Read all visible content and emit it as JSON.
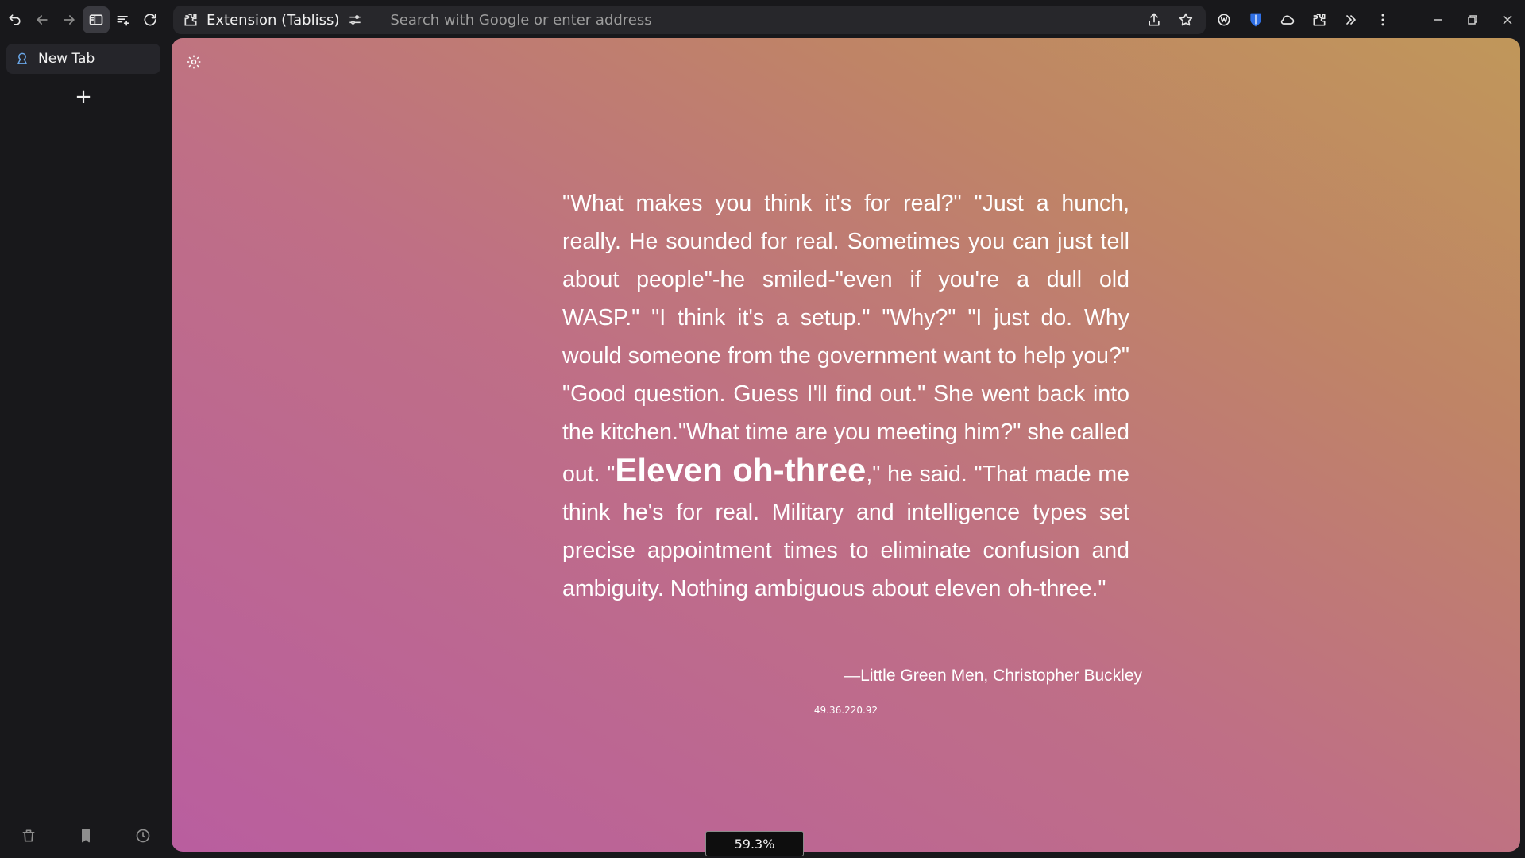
{
  "toolbar": {
    "icons": [
      "undo-icon",
      "back-icon",
      "forward-icon",
      "sidebar-icon",
      "reading-list-icon",
      "reload-icon"
    ]
  },
  "address_bar": {
    "site_label": "Extension (Tabliss)",
    "placeholder": "Search with Google or enter address"
  },
  "sidebar": {
    "tab_label": "New Tab",
    "new_tab_symbol": "+"
  },
  "quote": {
    "part1": "\"What makes you think it's for real?\" \"Just a hunch, really. He sounded for real. Sometimes you can just tell about people\"-he smiled-\"even if you're a dull old WASP.\" \"I think it's a setup.\" \"Why?\" \"I just do. Why would someone from the government want to help you?\" \"Good question. Guess I'll find out.\" She went back into the kitchen.\"What time are you meeting him?\" she called out. \"",
    "emphasis": "Eleven oh-three",
    "part2": ",\" he said. \"That made me think he's for real. Military and intelligence types set precise appointment times to eliminate confusion and ambiguity. Nothing ambiguous about eleven oh-three.\"",
    "attribution": "—Little Green Men, Christopher Buckley"
  },
  "ip_address": "49.36.220.92",
  "zoom_level": "59.3%",
  "colors": {
    "gradient_start": "#b95e9f",
    "gradient_end": "#c0975a",
    "chrome_bg": "#18181b"
  }
}
